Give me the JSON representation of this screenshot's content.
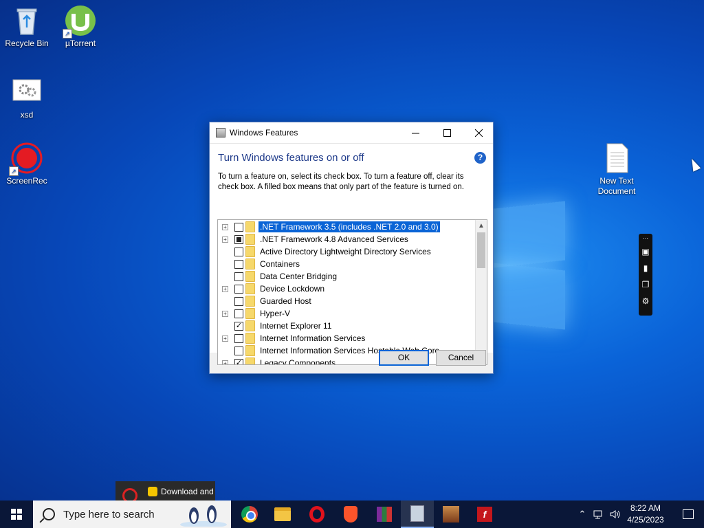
{
  "desktop": {
    "icons": [
      {
        "label": "Recycle Bin",
        "icon": "recycle-bin-icon"
      },
      {
        "label": "µTorrent",
        "icon": "utorrent-icon"
      },
      {
        "label": "xsd",
        "icon": "settings-file-icon"
      },
      {
        "label": "ScreenRec",
        "icon": "screenrec-icon"
      },
      {
        "label": "New Text\nDocument",
        "icon": "text-document-icon"
      }
    ]
  },
  "dialog": {
    "title": "Windows Features",
    "heading": "Turn Windows features on or off",
    "description": "To turn a feature on, select its check box. To turn a feature off, clear its check box. A filled box means that only part of the feature is turned on.",
    "features": [
      {
        "label": ".NET Framework 3.5 (includes .NET 2.0 and 3.0)",
        "state": "unchecked",
        "expandable": true,
        "selected": true
      },
      {
        "label": ".NET Framework 4.8 Advanced Services",
        "state": "partial",
        "expandable": true,
        "selected": false
      },
      {
        "label": "Active Directory Lightweight Directory Services",
        "state": "unchecked",
        "expandable": false,
        "selected": false
      },
      {
        "label": "Containers",
        "state": "unchecked",
        "expandable": false,
        "selected": false
      },
      {
        "label": "Data Center Bridging",
        "state": "unchecked",
        "expandable": false,
        "selected": false
      },
      {
        "label": "Device Lockdown",
        "state": "unchecked",
        "expandable": true,
        "selected": false
      },
      {
        "label": "Guarded Host",
        "state": "unchecked",
        "expandable": false,
        "selected": false
      },
      {
        "label": "Hyper-V",
        "state": "unchecked",
        "expandable": true,
        "selected": false
      },
      {
        "label": "Internet Explorer 11",
        "state": "checked",
        "expandable": false,
        "selected": false
      },
      {
        "label": "Internet Information Services",
        "state": "unchecked",
        "expandable": true,
        "selected": false
      },
      {
        "label": "Internet Information Services Hostable Web Core",
        "state": "unchecked",
        "expandable": false,
        "selected": false
      },
      {
        "label": "Legacy Components",
        "state": "checked",
        "expandable": true,
        "selected": false
      }
    ],
    "ok_label": "OK",
    "cancel_label": "Cancel"
  },
  "toast": {
    "text": "Download and"
  },
  "taskbar": {
    "search_placeholder": "Type here to search",
    "apps": [
      "chrome-icon",
      "file-explorer-icon",
      "opera-icon",
      "brave-icon",
      "winrar-icon",
      "generic-app-icon",
      "game-icon",
      "flash-icon"
    ],
    "time": "8:22 AM",
    "date": "4/25/2023"
  }
}
